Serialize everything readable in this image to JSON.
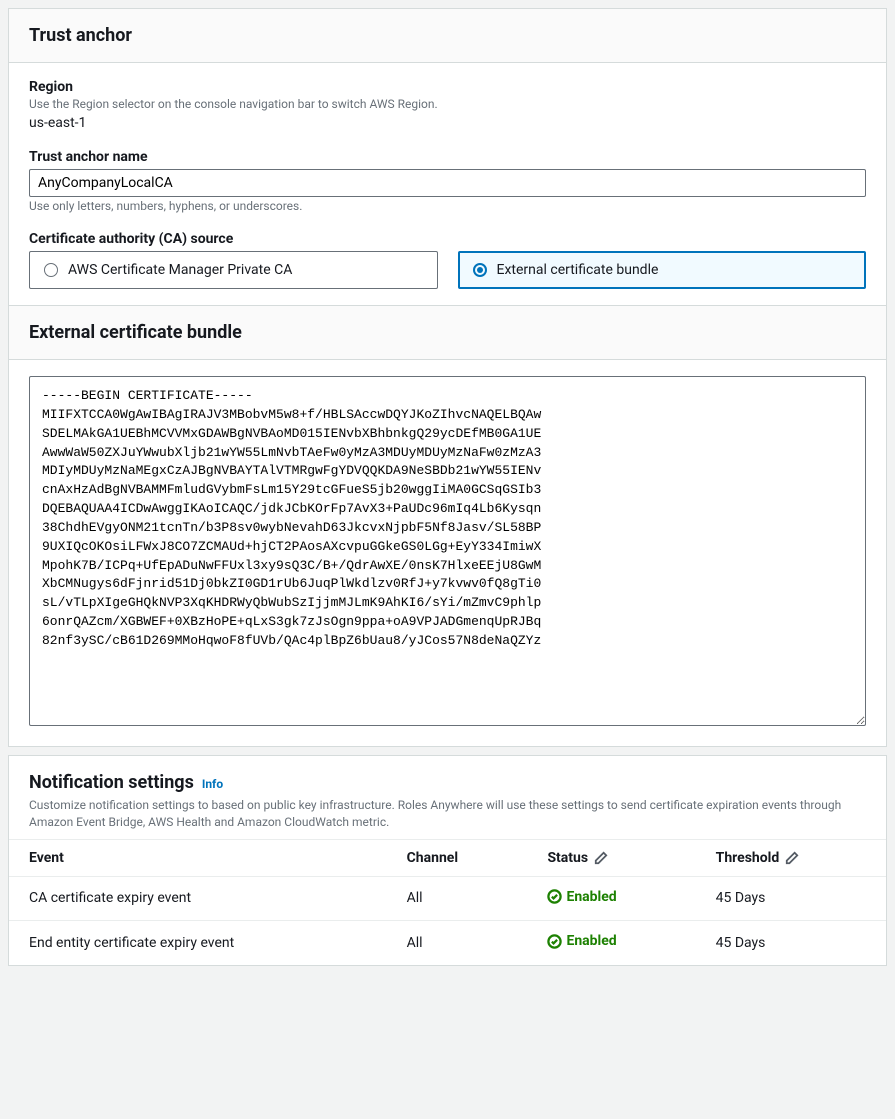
{
  "trustAnchor": {
    "title": "Trust anchor",
    "region": {
      "label": "Region",
      "helper": "Use the Region selector on the console navigation bar to switch AWS Region.",
      "value": "us-east-1"
    },
    "name": {
      "label": "Trust anchor name",
      "value": "AnyCompanyLocalCA",
      "helper": "Use only letters, numbers, hyphens, or underscores."
    },
    "caSource": {
      "label": "Certificate authority (CA) source",
      "options": [
        {
          "label": "AWS Certificate Manager Private CA",
          "selected": false
        },
        {
          "label": "External certificate bundle",
          "selected": true
        }
      ]
    }
  },
  "externalBundle": {
    "title": "External certificate bundle",
    "value": "-----BEGIN CERTIFICATE-----\nMIIFXTCCA0WgAwIBAgIRAJV3MBobvM5w8+f/HBLSAccwDQYJKoZIhvcNAQELBQAw\nSDELMAkGA1UEBhMCVVMxGDAWBgNVBAoMD015IENvbXBhbnkgQ29ycDEfMB0GA1UE\nAwwWaW50ZXJuYWwubXljb21wYW55LmNvbTAeFw0yMzA3MDUyMDUyMzNaFw0zMzA3\nMDIyMDUyMzNaMEgxCzAJBgNVBAYTAlVTMRgwFgYDVQQKDA9NeSBDb21wYW55IENv\ncnAxHzAdBgNVBAMMFmludGVybmFsLm15Y29tcGFueS5jb20wggIiMA0GCSqGSIb3\nDQEBAQUAA4ICDwAwggIKAoICAQC/jdkJCbKOrFp7AvX3+PaUDc96mIq4Lb6Kysqn\n38ChdhEVgyONM21tcnTn/b3P8sv0wybNevahD63JkcvxNjpbF5Nf8Jasv/SL58BP\n9UXIQcOKOsiLFWxJ8CO7ZCMAUd+hjCT2PAosAXcvpuGGkeGS0LGg+EyY334ImiwX\nMpohK7B/ICPq+UfEpADuNwFFUxl3xy9sQ3C/B+/QdrAwXE/0nsK7HlxeEEjU8GwM\nXbCMNugys6dFjnrid51Dj0bkZI0GD1rUb6JuqPlWkdlzv0RfJ+y7kvwv0fQ8gTi0\nsL/vTLpXIgeGHQkNVP3XqKHDRWyQbWubSzIjjmMJLmK9AhKI6/sYi/mZmvC9phlp\n6onrQAZcm/XGBWEF+0XBzHoPE+qLxS3gk7zJsOgn9ppa+oA9VPJADGmenqUpRJBq\n82nf3ySC/cB61D269MMoHqwoF8fUVb/QAc4plBpZ6bUau8/yJCos57N8deNaQZYz"
  },
  "notifications": {
    "title": "Notification settings",
    "info": "Info",
    "description": "Customize notification settings to based on public key infrastructure. Roles Anywhere will use these settings to send certificate expiration events through Amazon Event Bridge, AWS Health and Amazon CloudWatch metric.",
    "columns": {
      "event": "Event",
      "channel": "Channel",
      "status": "Status",
      "threshold": "Threshold"
    },
    "rows": [
      {
        "event": "CA certificate expiry event",
        "channel": "All",
        "status": "Enabled",
        "threshold": "45 Days"
      },
      {
        "event": "End entity certificate expiry event",
        "channel": "All",
        "status": "Enabled",
        "threshold": "45 Days"
      }
    ]
  }
}
